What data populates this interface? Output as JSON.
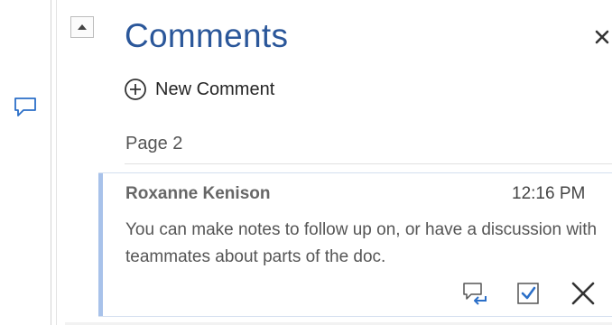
{
  "pane": {
    "title": "Comments",
    "new_comment_label": "New Comment",
    "page_label": "Page 2"
  },
  "icons": {
    "margin_comment": "speech-bubble-icon",
    "scroll_up": "triangle-up-icon",
    "close": "close-x-icon",
    "new_comment": "circle-plus-icon",
    "reply": "reply-icon",
    "resolve": "checkbox-icon",
    "delete": "x-icon"
  },
  "colors": {
    "accent": "#2b579a",
    "card_bar": "#a8c2ea"
  },
  "comments": [
    {
      "author": "Roxanne Kenison",
      "time": "12:16 PM",
      "text": "You can make notes to follow up on, or have a discussion with teammates about parts of the doc."
    }
  ]
}
